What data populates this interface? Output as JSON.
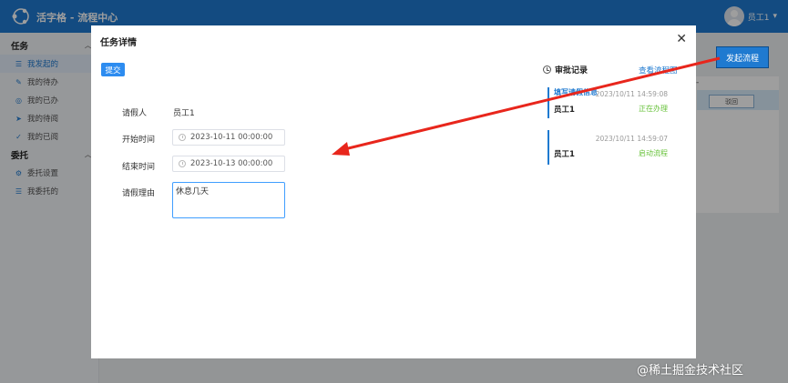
{
  "app": {
    "title": "活字格 - 流程中心",
    "user_name": "员工1"
  },
  "sidebar": {
    "groups": [
      {
        "title": "任务",
        "items": [
          {
            "label": "我发起的",
            "icon": "list-icon",
            "active": true
          },
          {
            "label": "我的待办",
            "icon": "edit-icon"
          },
          {
            "label": "我的已办",
            "icon": "check-circle-icon"
          },
          {
            "label": "我的待阅",
            "icon": "send-icon"
          },
          {
            "label": "我的已阅",
            "icon": "checkmark-icon"
          }
        ]
      },
      {
        "title": "委托",
        "items": [
          {
            "label": "委托设置",
            "icon": "gear-icon"
          },
          {
            "label": "我委托的",
            "icon": "list-icon"
          }
        ]
      }
    ]
  },
  "background": {
    "launch_button": "发起流程",
    "dot": "-",
    "table_button": "驳回"
  },
  "modal": {
    "title": "任务详情",
    "submit_label": "提交",
    "form": {
      "requester_label": "请假人",
      "requester_value": "员工1",
      "start_label": "开始时间",
      "start_value": "2023-10-11 00:00:00",
      "end_label": "结束时间",
      "end_value": "2023-10-13 00:00:00",
      "reason_label": "请假理由",
      "reason_value": "休息几天"
    },
    "approval": {
      "title": "审批记录",
      "flow_link": "查看流程图",
      "records": [
        {
          "node": "填写请假信息",
          "time": "2023/10/11 14:59:08",
          "user": "员工1",
          "status": "正在办理"
        },
        {
          "node": "",
          "time": "2023/10/11 14:59:07",
          "user": "员工1",
          "status": "启动流程"
        }
      ]
    }
  },
  "watermark": "@稀土掘金技术社区",
  "colors": {
    "primary": "#1f7ad0",
    "button": "#2d8cf0",
    "status_green": "#67c23a",
    "arrow_red": "#e8261c"
  }
}
